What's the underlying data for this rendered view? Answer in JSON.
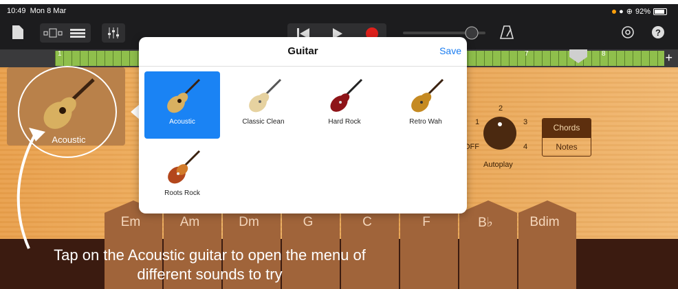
{
  "status": {
    "time": "10:49",
    "date": "Mon 8 Mar",
    "battery": "92%"
  },
  "ruler": {
    "marks": [
      "1",
      "7",
      "8"
    ]
  },
  "instrument": {
    "label": "Acoustic"
  },
  "popover": {
    "title": "Guitar",
    "save_label": "Save",
    "items": [
      {
        "label": "Acoustic",
        "selected": true,
        "icon": "acoustic-guitar-icon"
      },
      {
        "label": "Classic Clean",
        "selected": false,
        "icon": "classic-clean-guitar-icon"
      },
      {
        "label": "Hard Rock",
        "selected": false,
        "icon": "hard-rock-guitar-icon"
      },
      {
        "label": "Retro Wah",
        "selected": false,
        "icon": "retro-wah-guitar-icon"
      },
      {
        "label": "Roots Rock",
        "selected": false,
        "icon": "roots-rock-guitar-icon"
      }
    ]
  },
  "autoplay": {
    "label": "Autoplay",
    "positions": [
      "OFF",
      "1",
      "2",
      "3",
      "4"
    ]
  },
  "mode": {
    "chords_label": "Chords",
    "notes_label": "Notes",
    "active": "Chords"
  },
  "chords": [
    "Em",
    "Am",
    "Dm",
    "G",
    "C",
    "F",
    "B♭",
    "Bdim"
  ],
  "caption": {
    "line1": "Tap on the Acoustic guitar to open the menu of",
    "line2": "different sounds to try"
  },
  "colors": {
    "accent": "#1a83f4",
    "wood": "#f0b466",
    "chord": "#a0643a"
  }
}
